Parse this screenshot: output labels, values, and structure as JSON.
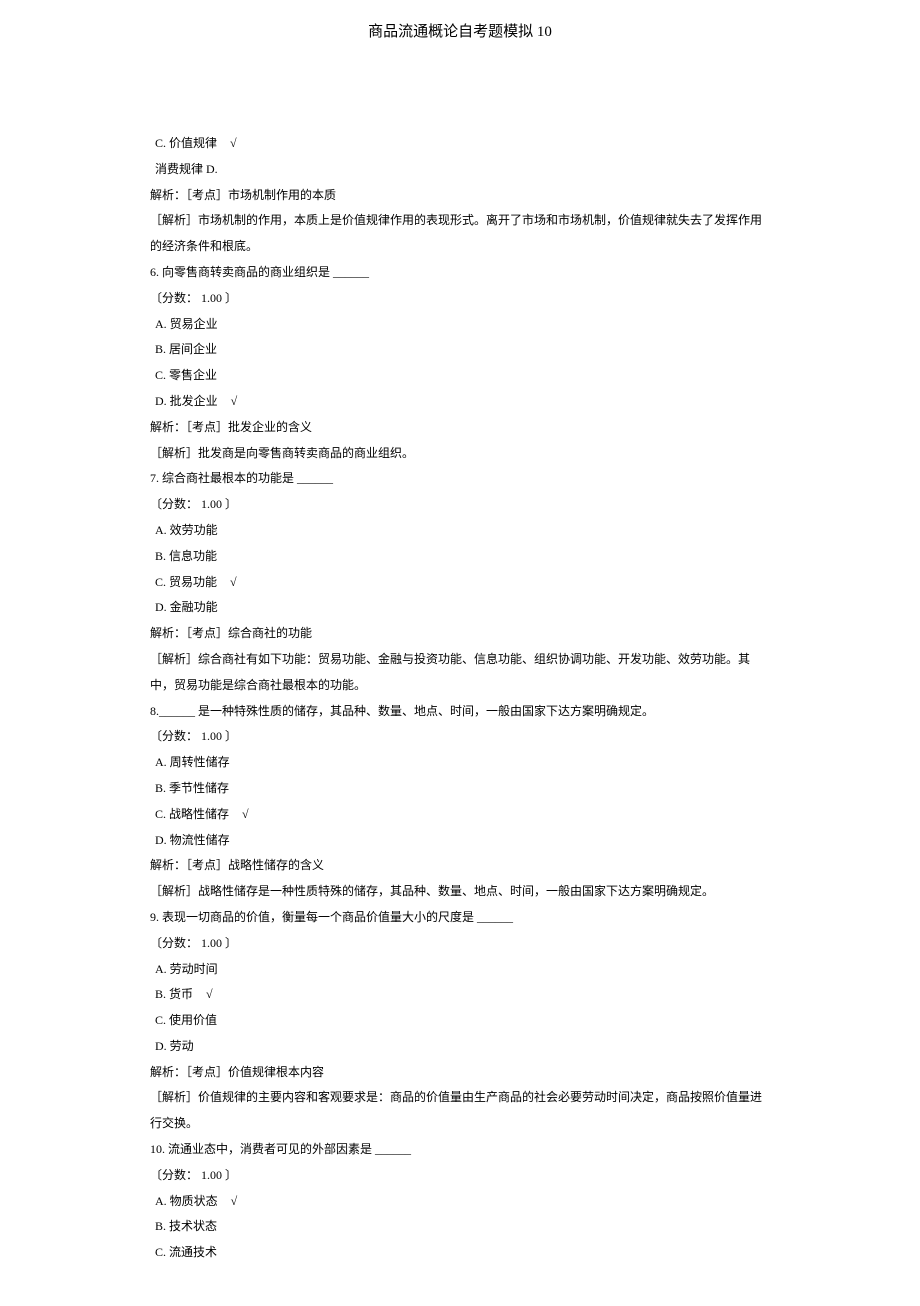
{
  "title": "商品流通概论自考题模拟 10",
  "prev_tail": {
    "optC": "C. 价值规律",
    "optC_checked": "√",
    "optD_text": "消费规律 D.",
    "analysis_label": "解析：［考点］市场机制作用的本质",
    "analysis_body": "［解析］市场机制的作用，本质上是价值规律作用的表现形式。离开了市场和市场机制，价值规律就失去了发挥作用的经济条件和根底。"
  },
  "q6": {
    "stem": "6. 向零售商转卖商品的商业组织是   ______",
    "score": "〔分数： 1.00 〕",
    "A": "A. 贸易企业",
    "B": "B. 居间企业",
    "C": "C. 零售企业",
    "D": "D. 批发企业",
    "D_checked": "√",
    "point": "解析：［考点］批发企业的含义",
    "analysis": "［解析］批发商是向零售商转卖商品的商业组织。"
  },
  "q7": {
    "stem": "7. 综合商社最根本的功能是   ______",
    "score": "〔分数： 1.00 〕",
    "A": "A. 效劳功能",
    "B": "B. 信息功能",
    "C": "C. 贸易功能",
    "C_checked": "√",
    "D": "D. 金融功能",
    "point": "解析：［考点］综合商社的功能",
    "analysis": "［解析］综合商社有如下功能：贸易功能、金融与投资功能、信息功能、组织协调功能、开发功能、效劳功能。其中，贸易功能是综合商社最根本的功能。"
  },
  "q8": {
    "stem": "8.______ 是一种特殊性质的储存，其品种、数量、地点、时间，一般由国家下达方案明确规定。",
    "score": "〔分数： 1.00 〕",
    "A": "A. 周转性储存",
    "B": "B. 季节性储存",
    "C": "C. 战略性储存",
    "C_checked": "√",
    "D": "D. 物流性储存",
    "point": "解析：［考点］战略性储存的含义",
    "analysis": "［解析］战略性储存是一种性质特殊的储存，其品种、数量、地点、时间，一般由国家下达方案明确规定。"
  },
  "q9": {
    "stem": "9. 表现一切商品的价值，衡量每一个商品价值量大小的尺度是     ______",
    "score": "〔分数： 1.00 〕",
    "A": "A. 劳动时间",
    "B": "B. 货币",
    "B_checked": "√",
    "C": "C. 使用价值",
    "D": "D. 劳动",
    "point": "解析：［考点］价值规律根本内容",
    "analysis": "［解析］价值规律的主要内容和客观要求是：商品的价值量由生产商品的社会必要劳动时间决定，商品按照价值量进行交换。"
  },
  "q10": {
    "stem": "10. 流通业态中，消费者可见的外部因素是   ______",
    "score": "〔分数： 1.00 〕",
    "A": "A. 物质状态",
    "A_checked": "√",
    "B": "B. 技术状态",
    "C": "C. 流通技术"
  }
}
